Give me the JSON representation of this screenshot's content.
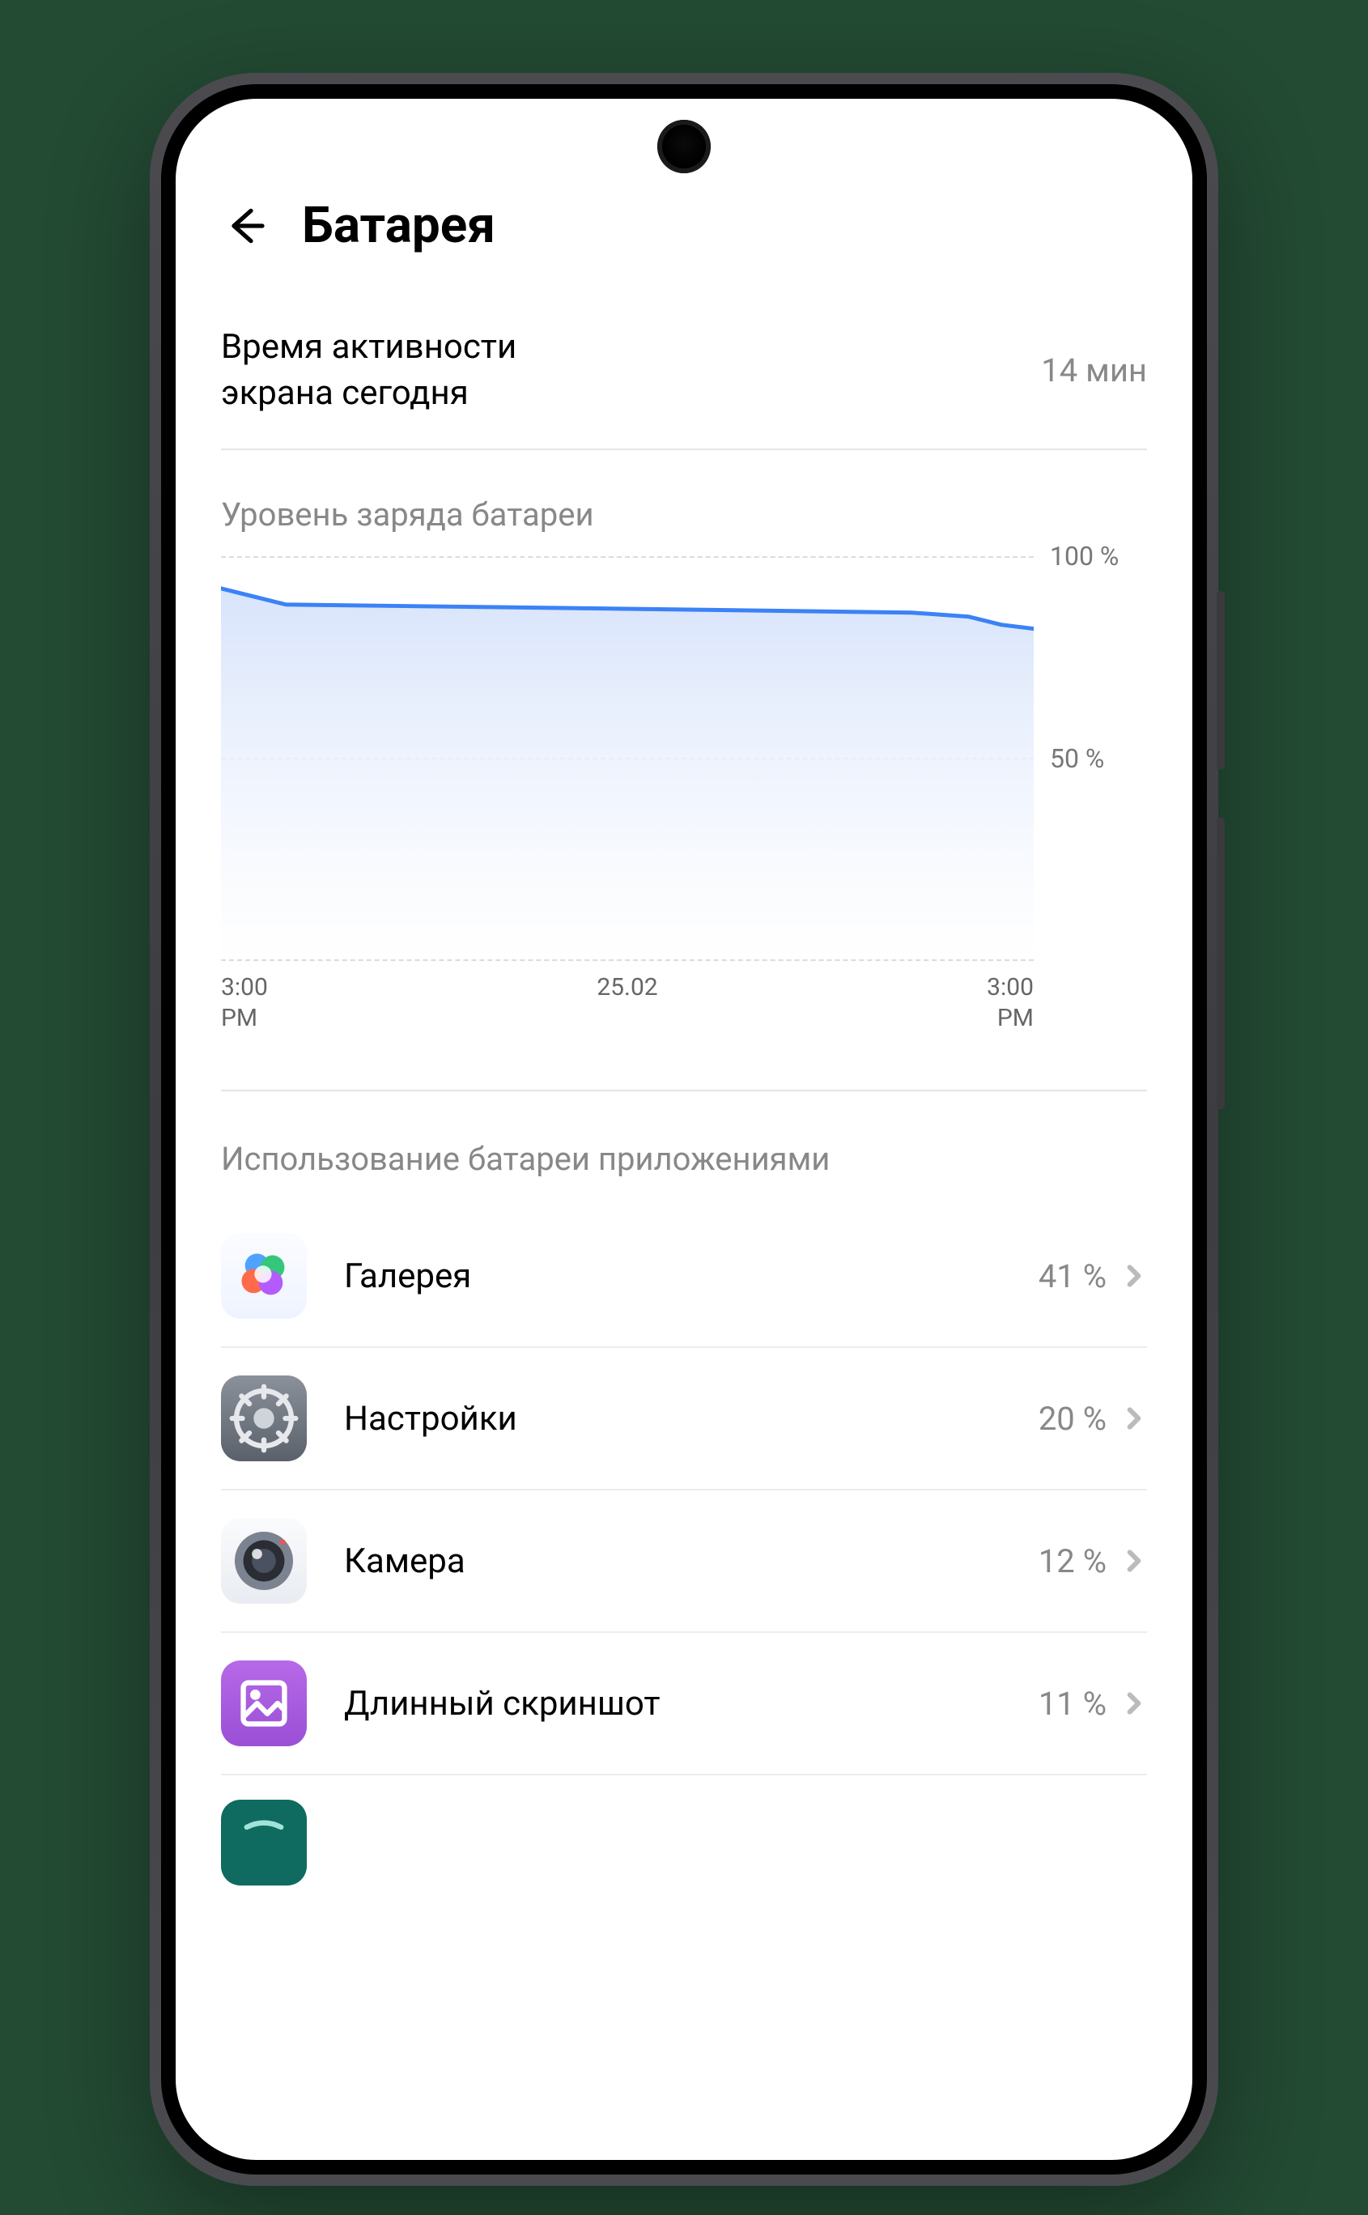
{
  "header": {
    "title": "Батарея"
  },
  "screen_time": {
    "label_line1": "Время активности",
    "label_line2": "экрана сегодня",
    "value": "14 мин"
  },
  "chart_section": {
    "title": "Уровень заряда батареи",
    "y_tick_100": "100 %",
    "y_tick_50": "50 %",
    "x_tick_start_top": "3:00",
    "x_tick_start_bottom": "PM",
    "x_tick_mid": "25.02",
    "x_tick_end_top": "3:00",
    "x_tick_end_bottom": "PM"
  },
  "usage_section": {
    "title": "Использование батареи приложениями",
    "apps": [
      {
        "name": "Галерея",
        "value": "41 %",
        "icon": "gallery"
      },
      {
        "name": "Настройки",
        "value": "20 %",
        "icon": "settings"
      },
      {
        "name": "Камера",
        "value": "12 %",
        "icon": "camera"
      },
      {
        "name": "Длинный скриншот",
        "value": "11 %",
        "icon": "screenshot"
      }
    ]
  },
  "chart_data": {
    "type": "area",
    "title": "Уровень заряда батареи",
    "ylabel": "%",
    "ylim": [
      0,
      100
    ],
    "x": [
      0,
      2,
      8,
      48,
      85,
      92,
      96,
      100
    ],
    "values": [
      92,
      91,
      88,
      87,
      86,
      85,
      83,
      82
    ],
    "x_ticks": [
      "3:00 PM",
      "25.02",
      "3:00 PM"
    ]
  },
  "colors": {
    "chart_line": "#3b82f6",
    "chart_fill_top": "#d8e4fb",
    "chart_fill_bottom": "#ffffff"
  }
}
